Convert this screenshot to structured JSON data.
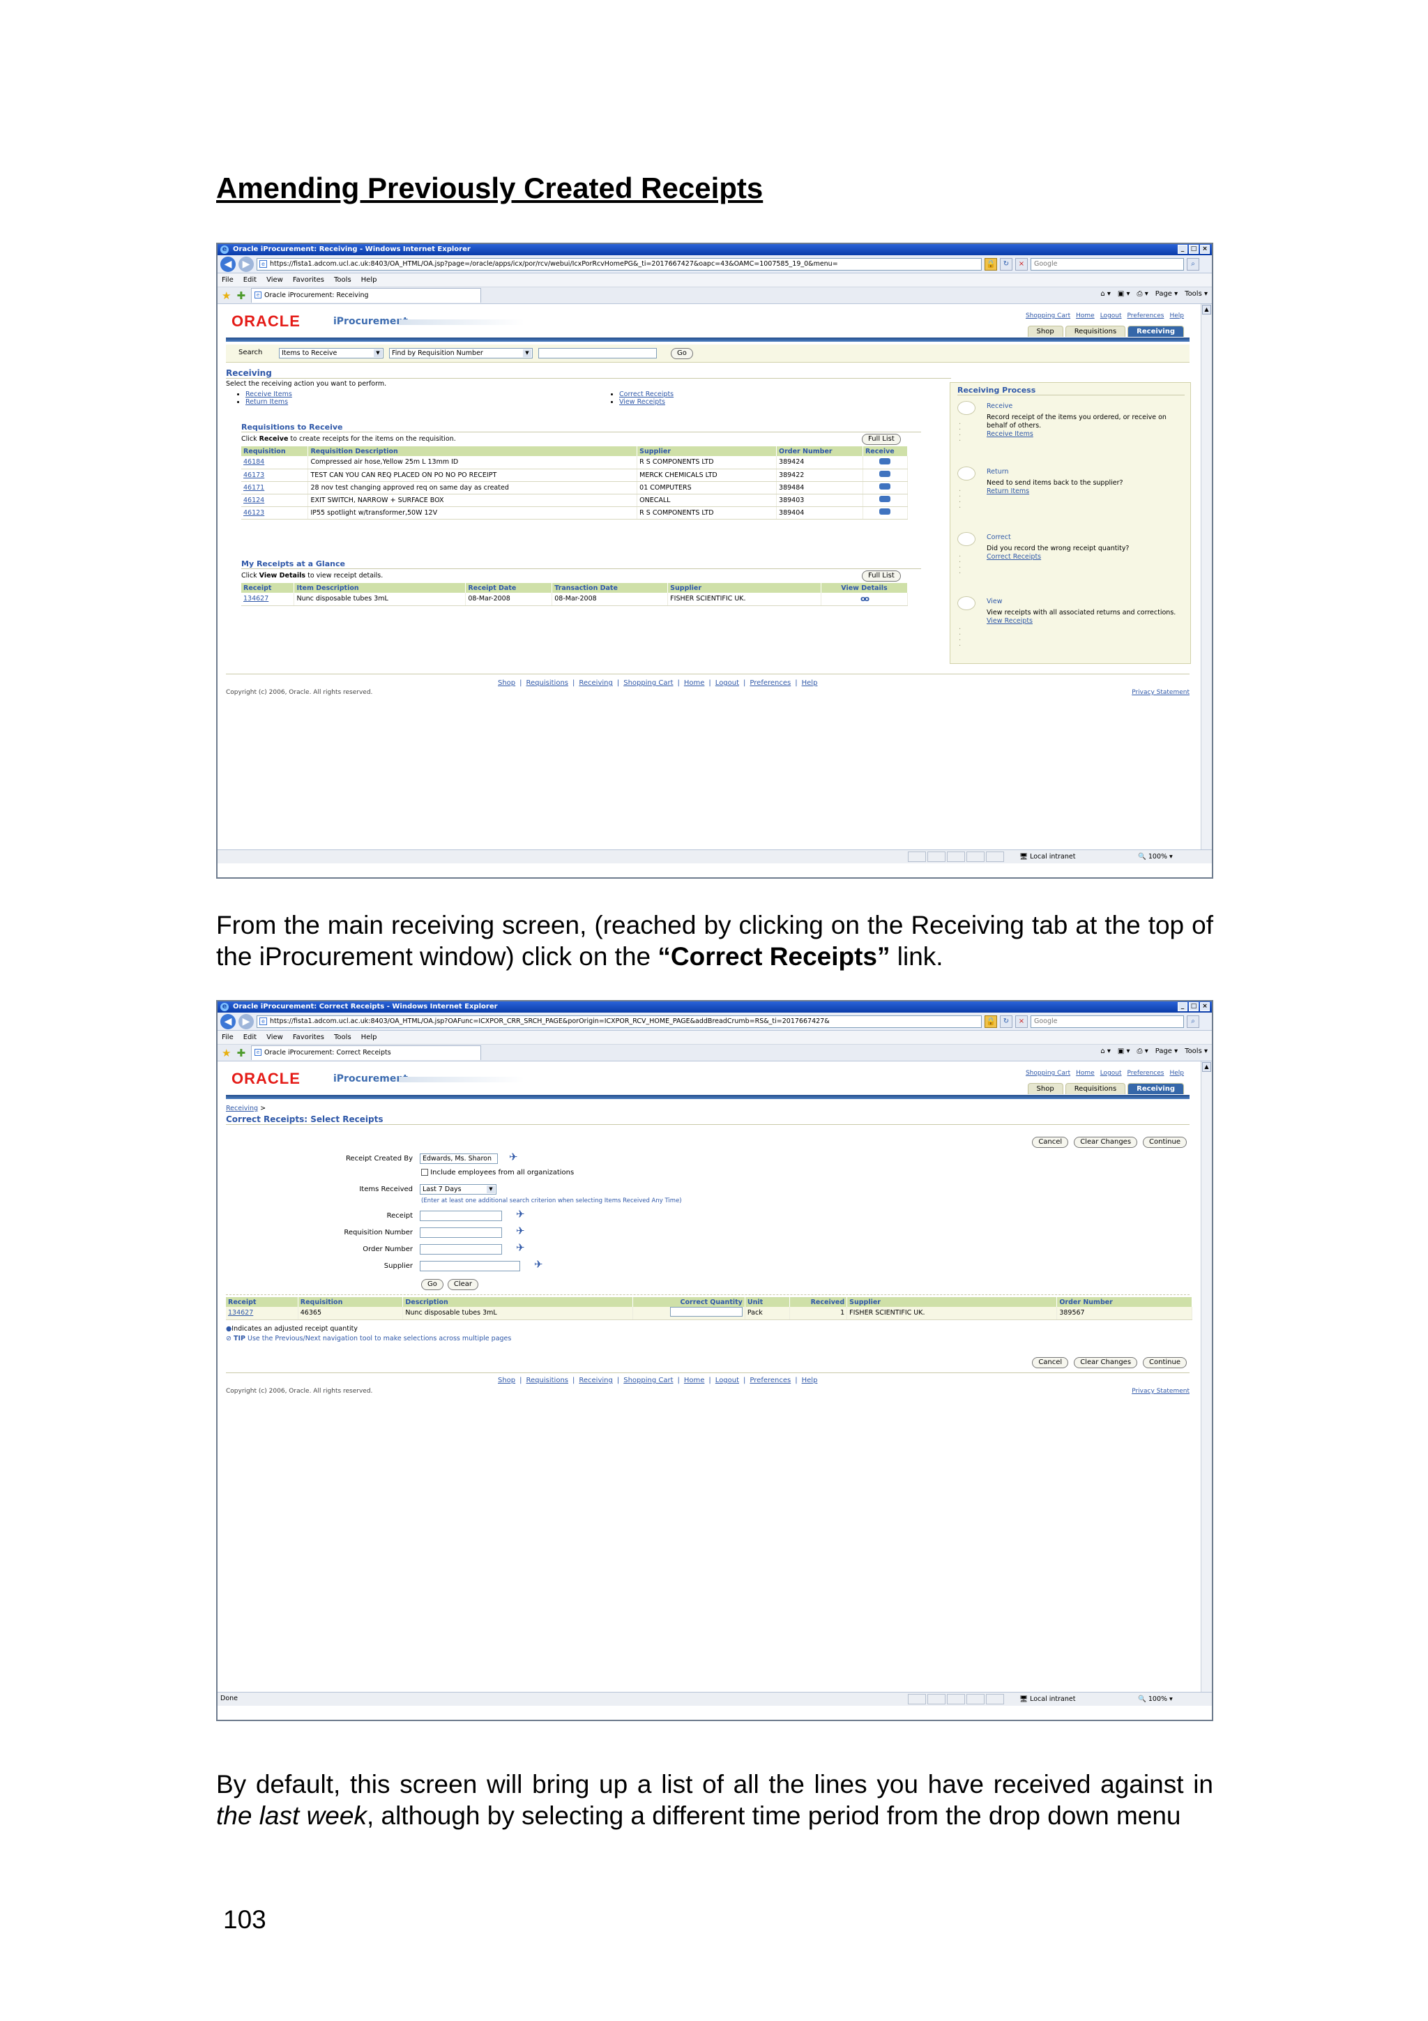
{
  "heading": "Amending Previously Created Receipts",
  "para1": {
    "before": "From the main receiving screen, (reached by clicking on the Receiving tab at the top of the iProcurement window) click on the ",
    "bold": "“Correct Receipts”",
    "after": " link."
  },
  "para2": {
    "before": "By default, this screen will bring up a list of all the lines you have received against in ",
    "italic": "the last week",
    "after": ", although by selecting a different time period from the drop down menu"
  },
  "page_number": "103",
  "browser": {
    "menu": [
      "File",
      "Edit",
      "View",
      "Favorites",
      "Tools",
      "Help"
    ],
    "search_placeholder": "Google",
    "cmd": [
      "Page ▾",
      "Tools ▾"
    ],
    "status_zone": "Local intranet",
    "zoom": "100%",
    "status_done": "Done"
  },
  "shot1": {
    "window_title": "Oracle iProcurement: Receiving - Windows Internet Explorer",
    "url": "https://fista1.adcom.ucl.ac.uk:8403/OA_HTML/OA.jsp?page=/oracle/apps/icx/por/rcv/webui/IcxPorRcvHomePG&_ti=2017667427&oapc=43&OAMC=1007585_19_0&menu=",
    "tab_title": "Oracle iProcurement: Receiving",
    "brand": "ORACLE",
    "product": "iProcurement",
    "global_links": [
      "Shopping Cart",
      "Home",
      "Logout",
      "Preferences",
      "Help"
    ],
    "tabs": [
      "Shop",
      "Requisitions",
      "Receiving"
    ],
    "search_label": "Search",
    "search_select": "Items to Receive",
    "search_by": "Find by Requisition Number",
    "go": "Go",
    "section": "Receiving",
    "instruction": "Select the receiving action you want to perform.",
    "actions_left": [
      "Receive Items",
      "Return Items"
    ],
    "actions_right": [
      "Correct Receipts",
      "View Receipts"
    ],
    "req_title": "Requisitions to Receive",
    "req_hint_pre": "Click ",
    "req_hint_bold": "Receive",
    "req_hint_post": " to create receipts for the items on the requisition.",
    "full_list": "Full List",
    "req_headers": [
      "Requisition",
      "Requisition Description",
      "Supplier",
      "Order Number",
      "Receive"
    ],
    "req_rows": [
      [
        "46184",
        "Compressed air hose,Yellow 25m L 13mm ID",
        "R S COMPONENTS LTD",
        "389424"
      ],
      [
        "46173",
        "TEST CAN YOU CAN REQ PLACED ON PO NO PO RECEIPT",
        "MERCK CHEMICALS LTD",
        "389422"
      ],
      [
        "46171",
        "28 nov test changing approved req on same day as created",
        "01 COMPUTERS",
        "389484"
      ],
      [
        "46124",
        "EXIT SWITCH, NARROW + SURFACE BOX",
        "ONECALL",
        "389403"
      ],
      [
        "46123",
        "IP55 spotlight w/transformer,50W 12V",
        "R S COMPONENTS LTD",
        "389404"
      ]
    ],
    "glance_title": "My Receipts at a Glance",
    "glance_hint_pre": "Click ",
    "glance_hint_bold": "View Details",
    "glance_hint_post": " to view receipt details.",
    "glance_headers": [
      "Receipt",
      "Item Description",
      "Receipt Date",
      "Transaction Date",
      "Supplier",
      "View Details"
    ],
    "glance_rows": [
      [
        "134627",
        "Nunc disposable tubes 3mL",
        "08-Mar-2008",
        "08-Mar-2008",
        "FISHER SCIENTIFIC UK."
      ]
    ],
    "process_title": "Receiving Process",
    "process_steps": [
      {
        "name": "Receive",
        "desc": "Record receipt of the items you ordered, or receive on behalf of others.",
        "link": "Receive Items"
      },
      {
        "name": "Return",
        "desc": "Need to send items back to the supplier?",
        "link": "Return Items"
      },
      {
        "name": "Correct",
        "desc": "Did you record the wrong receipt quantity?",
        "link": "Correct Receipts"
      },
      {
        "name": "View",
        "desc": "View receipts with all associated returns and corrections.",
        "link": "View Receipts"
      }
    ],
    "footer_links": [
      "Shop",
      "Requisitions",
      "Receiving",
      "Shopping Cart",
      "Home",
      "Logout",
      "Preferences",
      "Help"
    ],
    "copyright": "Copyright (c) 2006, Oracle. All rights reserved.",
    "privacy": "Privacy Statement"
  },
  "shot2": {
    "window_title": "Oracle iProcurement: Correct Receipts - Windows Internet Explorer",
    "url": "https://fista1.adcom.ucl.ac.uk:8403/OA_HTML/OA.jsp?OAFunc=ICXPOR_CRR_SRCH_PAGE&porOrigin=ICXPOR_RCV_HOME_PAGE&addBreadCrumb=RS&_ti=2017667427&",
    "tab_title": "Oracle iProcurement: Correct Receipts",
    "breadcrumb": "Receiving",
    "page_title": "Correct Receipts: Select Receipts",
    "buttons": [
      "Cancel",
      "Clear Changes",
      "Continue"
    ],
    "labels": {
      "created_by": "Receipt Created By",
      "include": "Include employees from all organizations",
      "items_received": "Items Received",
      "hint": "(Enter at least one additional search criterion when selecting Items Received Any Time)",
      "receipt": "Receipt",
      "requisition": "Requisition Number",
      "order": "Order Number",
      "supplier": "Supplier"
    },
    "created_by_value": "Edwards, Ms. Sharon",
    "items_received_value": "Last 7 Days",
    "go": "Go",
    "clear": "Clear",
    "headers": [
      "Receipt",
      "Requisition",
      "Description",
      "Correct Quantity",
      "Unit",
      "Received",
      "Supplier",
      "Order Number"
    ],
    "row": {
      "receipt": "134627",
      "requisition": "46365",
      "description": "Nunc disposable tubes 3mL",
      "unit": "Pack",
      "received": "1",
      "supplier": "FISHER SCIENTIFIC UK.",
      "order": "389567"
    },
    "note1": "Indicates an adjusted receipt quantity",
    "note2_bold": "TIP",
    "note2": " Use the Previous/Next navigation tool to make selections across multiple pages",
    "footer_links": [
      "Shop",
      "Requisitions",
      "Receiving",
      "Shopping Cart",
      "Home",
      "Logout",
      "Preferences",
      "Help"
    ],
    "copyright": "Copyright (c) 2006, Oracle. All rights reserved.",
    "privacy": "Privacy Statement"
  }
}
